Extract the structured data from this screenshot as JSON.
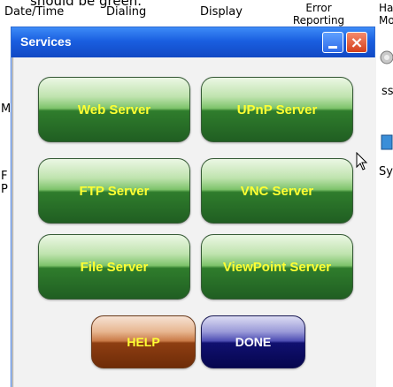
{
  "background": {
    "top_items": [
      "Date/Time",
      "Dialing",
      "Display",
      "Error Reporting",
      "Har Mo"
    ],
    "left_fragments": [
      "M",
      "F",
      "P"
    ],
    "right_fragments": [
      "ss",
      "Sys"
    ],
    "top_caption": "should be green."
  },
  "window": {
    "title": "Services",
    "minimize_label": "_",
    "close_label": "×"
  },
  "buttons": {
    "web_server": "Web Server",
    "upnp_server": "UPnP Server",
    "ftp_server": "FTP Server",
    "vnc_server": "VNC Server",
    "file_server": "File Server",
    "viewpoint_server": "ViewPoint Server",
    "help": "HELP",
    "done": "DONE"
  },
  "colors": {
    "green_button": "#2f7d2c",
    "help_button": "#8e3e12",
    "done_button": "#101070",
    "label_yellow": "#ffff33",
    "title_blue": "#1a5fe0"
  }
}
